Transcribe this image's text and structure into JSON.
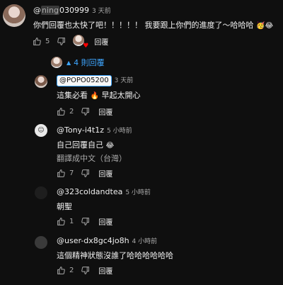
{
  "comments": [
    {
      "author_pre": "@",
      "author_hl": "ning",
      "author_post": "030999",
      "time": "3 天前",
      "text": "你們回覆也太快了吧！！！！！ 我要跟上你們的進度了～哈哈哈",
      "emoji": "🥳😂",
      "likes": "5",
      "reply_label": "回覆"
    }
  ],
  "replies_toggle": {
    "label": "4 則回覆"
  },
  "replies": [
    {
      "author": "@POPO05200",
      "time": "3 天前",
      "text_before": "這集必看",
      "emoji": "🔥",
      "text_after": "早起太開心",
      "likes": "2",
      "reply_label": "回覆"
    },
    {
      "author": "@Tony-i4t1z",
      "time": "5 小時前",
      "text": "自己回覆自己",
      "emoji": "😂",
      "translate": "翻譯成中文（台灣）",
      "likes": "7",
      "reply_label": "回覆"
    },
    {
      "author": "@323coldandtea",
      "time": "5 小時前",
      "text": "朝聖",
      "likes": "1",
      "reply_label": "回覆"
    },
    {
      "author": "@user-dx8gc4jo8h",
      "time": "4 小時前",
      "text": "這個精神狀態沒誰了哈哈哈哈哈哈",
      "likes": "2",
      "reply_label": "回覆"
    }
  ],
  "colors": {
    "background": "#0f0f0f",
    "link": "#3ea6ff",
    "heart": "#ff0000"
  }
}
